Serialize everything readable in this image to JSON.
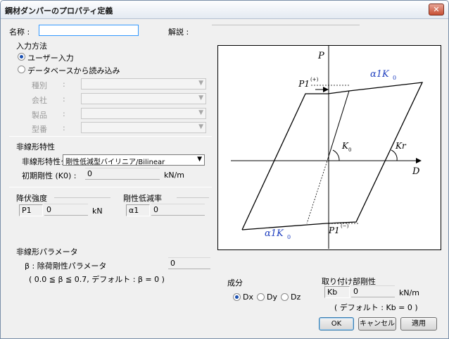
{
  "window": {
    "title": "鋼材ダンパーのプロパティ定義",
    "close_label": "✕"
  },
  "name": {
    "label": "名称 :",
    "value": ""
  },
  "description": {
    "label": "解説 :"
  },
  "input_method": {
    "title": "入力方法",
    "options": [
      "ユーザー入力",
      "データベースから読み込み"
    ],
    "selected": 0,
    "db_fields": [
      {
        "label": "種別",
        "colon": ":"
      },
      {
        "label": "会社",
        "colon": ":"
      },
      {
        "label": "製品",
        "colon": ":"
      },
      {
        "label": "型番",
        "colon": ":"
      }
    ]
  },
  "nonlinear": {
    "title": "非線形特性",
    "type_label": "非線形特性タ",
    "type_value": "剛性低減型バイリニア/Bilinear",
    "k0_label": "初期剛性 (K0) :",
    "k0_value": "0",
    "k0_unit": "kN/m"
  },
  "yield": {
    "title": "降伏強度",
    "p1_label": "P1",
    "p1_value": "0",
    "unit": "kN"
  },
  "reduction": {
    "title": "剛性低減率",
    "alpha_label": "α1",
    "alpha_value": "0"
  },
  "params": {
    "title": "非線形パラメータ",
    "beta_label": "β : 除荷剛性パラメータ",
    "beta_value": "0",
    "note": "( 0.0 ≦ β ≦ 0.7, デフォルト : β = 0 )"
  },
  "diagram": {
    "axis_p": "P",
    "axis_d": "D",
    "p1_plus": "P1",
    "p1_plus_sup": "(+)",
    "p1_minus": "P1",
    "p1_minus_sup": "(−)",
    "alpha_top": "α1K",
    "alpha_top_sub": "0",
    "alpha_bottom": "α1K",
    "alpha_bottom_sub": "0",
    "k0": "K",
    "k0_sub": "0",
    "kr": "Kr",
    "alpha_color": "#1f3fbf"
  },
  "component": {
    "title": "成分",
    "options": [
      "Dx",
      "Dy",
      "Dz"
    ],
    "selected": 0
  },
  "attachment": {
    "title": "取り付け部剛性",
    "kb_label": "Kb",
    "kb_value": "0",
    "unit": "kN/m",
    "note": "( デフォルト : Kb = 0 )"
  },
  "buttons": {
    "ok": "OK",
    "cancel": "キャンセル",
    "apply": "適用"
  }
}
